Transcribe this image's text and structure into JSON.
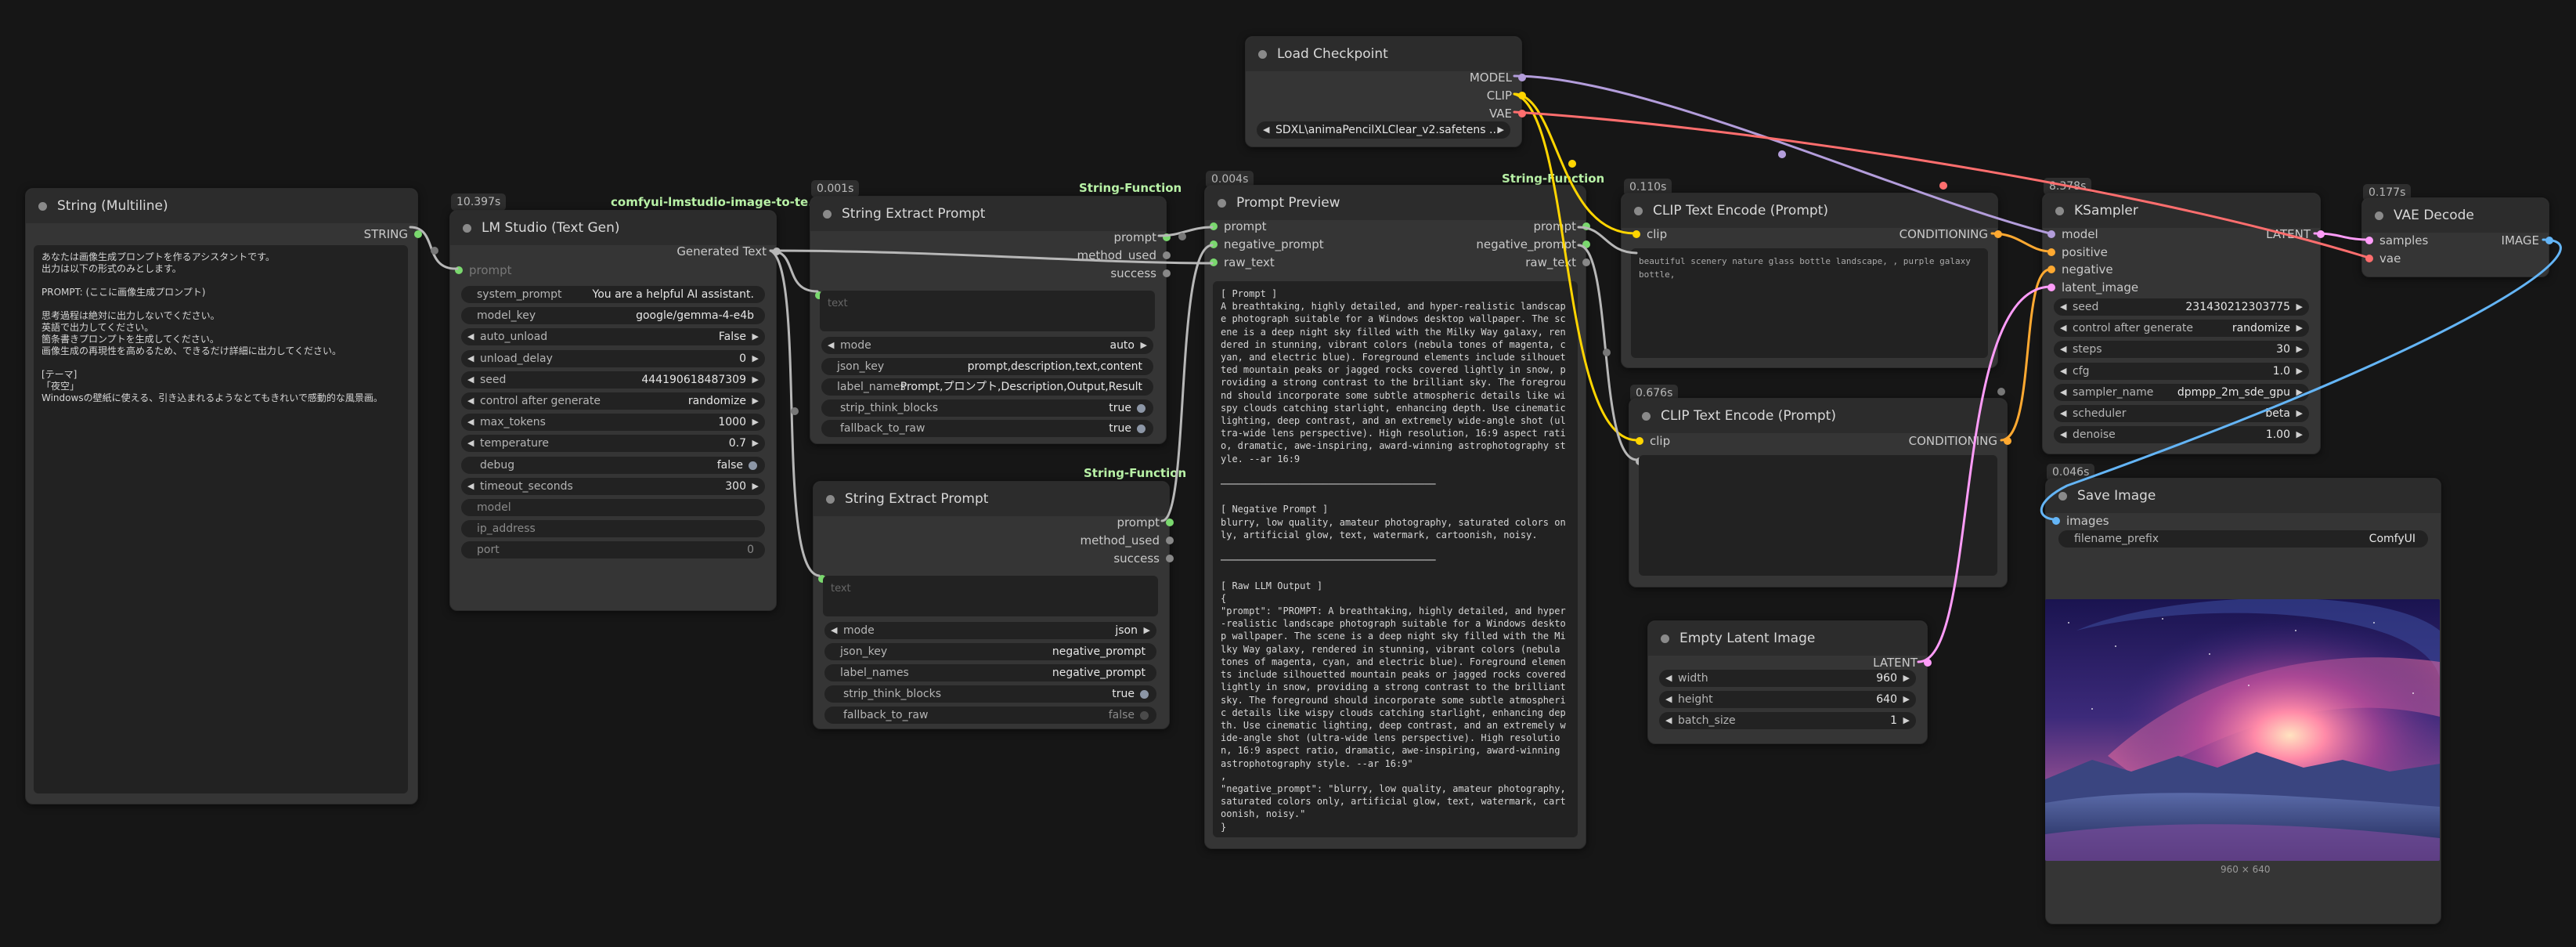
{
  "colors": {
    "model": "#b39ddb",
    "clip": "#ffd500",
    "vae": "#ff6e6e",
    "conditioning": "#ffa931",
    "latent": "#ff9cf9",
    "image": "#64b5f6",
    "string": "#7ad86e",
    "wire": "#b7b7b7"
  },
  "nodes": {
    "string_multiline": {
      "title": "String (Multiline)",
      "out_string": "STRING",
      "text": "あなたは画像生成プロンプトを作るアシスタントです。\n出力は以下の形式のみとします。\n\nPROMPT: (ここに画像生成プロンプト)\n\n思考過程は絶対に出力しないでください。\n英語で出力してください。\n箇条書きプロンプトを生成してください。\n画像生成の再現性を高めるため、できるだけ詳細に出力してください。\n\n[テーマ]\n「夜空」\nWindowsの壁紙に使える、引き込まれるようなとてもきれいで感動的な風景画。"
    },
    "lm_studio": {
      "badge": "10.397s",
      "tag": "comfyui-lmstudio-image-to-te...",
      "title": "LM Studio (Text Gen)",
      "out_generated": "Generated Text",
      "in_prompt": "prompt",
      "widgets": [
        {
          "label": "system_prompt",
          "value": "You are a helpful AI assistant.",
          "kind": "plain"
        },
        {
          "label": "model_key",
          "value": "google/gemma-4-e4b",
          "kind": "plain"
        },
        {
          "label": "auto_unload",
          "value": "False",
          "kind": "combo"
        },
        {
          "label": "unload_delay",
          "value": "0",
          "kind": "number"
        },
        {
          "label": "seed",
          "value": "444190618487309",
          "kind": "number"
        },
        {
          "label": "control after generate",
          "value": "randomize",
          "kind": "combo"
        },
        {
          "label": "max_tokens",
          "value": "1000",
          "kind": "number"
        },
        {
          "label": "temperature",
          "value": "0.7",
          "kind": "number"
        },
        {
          "label": "debug",
          "value": "false",
          "kind": "toggle"
        },
        {
          "label": "timeout_seconds",
          "value": "300",
          "kind": "number"
        },
        {
          "label": "model",
          "value": "",
          "kind": "plain"
        },
        {
          "label": "ip_address",
          "value": "",
          "kind": "plain"
        },
        {
          "label": "port",
          "value": "0",
          "kind": "plain"
        }
      ]
    },
    "extract_1": {
      "badge": "0.001s",
      "tag": "String-Function",
      "title": "String Extract Prompt",
      "outputs": [
        "prompt",
        "method_used",
        "success"
      ],
      "input_placeholder": "text",
      "widgets": [
        {
          "label": "mode",
          "value": "auto",
          "kind": "combo"
        },
        {
          "label": "json_key",
          "value": "prompt,description,text,content",
          "kind": "plain"
        },
        {
          "label": "label_names",
          "value": "Prompt,プロンプト,Description,Output,Result",
          "kind": "plain"
        },
        {
          "label": "strip_think_blocks",
          "value": "true",
          "kind": "toggle"
        },
        {
          "label": "fallback_to_raw",
          "value": "true",
          "kind": "toggle"
        }
      ]
    },
    "extract_2": {
      "tag": "String-Function",
      "title": "String Extract Prompt",
      "outputs": [
        "prompt",
        "method_used",
        "success"
      ],
      "input_placeholder": "text",
      "widgets": [
        {
          "label": "mode",
          "value": "json",
          "kind": "combo"
        },
        {
          "label": "json_key",
          "value": "negative_prompt",
          "kind": "plain"
        },
        {
          "label": "label_names",
          "value": "negative_prompt",
          "kind": "plain"
        },
        {
          "label": "strip_think_blocks",
          "value": "true",
          "kind": "toggle"
        },
        {
          "label": "fallback_to_raw",
          "value": "false",
          "kind": "toggle-off"
        }
      ]
    },
    "prompt_preview": {
      "badge": "0.004s",
      "tag": "String-Function",
      "title": "Prompt Preview",
      "inputs": [
        "prompt",
        "negative_prompt",
        "raw_text"
      ],
      "outputs": [
        "prompt",
        "negative_prompt",
        "raw_text"
      ],
      "text": "[ Prompt ]\nA breathtaking, highly detailed, and hyper-realistic landscape photograph suitable for a Windows desktop wallpaper. The scene is a deep night sky filled with the Milky Way galaxy, rendered in stunning, vibrant colors (nebula tones of magenta, cyan, and electric blue). Foreground elements include silhouetted mountain peaks or jagged rocks covered lightly in snow, providing a strong contrast to the brilliant sky. The foreground should incorporate some subtle atmospheric details like wispy clouds catching starlight, enhancing depth. Use cinematic lighting, deep contrast, and an extremely wide-angle shot (ultra-wide lens perspective). High resolution, 16:9 aspect ratio, dramatic, awe-inspiring, award-winning astrophotography style. --ar 16:9\n\n──────────────────────────────────────\n\n[ Negative Prompt ]\nblurry, low quality, amateur photography, saturated colors only, artificial glow, text, watermark, cartoonish, noisy.\n\n──────────────────────────────────────\n\n[ Raw LLM Output ]\n{\n\"prompt\": \"PROMPT: A breathtaking, highly detailed, and hyper-realistic landscape photograph suitable for a Windows desktop wallpaper. The scene is a deep night sky filled with the Milky Way galaxy, rendered in stunning, vibrant colors (nebula tones of magenta, cyan, and electric blue). Foreground elements include silhouetted mountain peaks or jagged rocks covered lightly in snow, providing a strong contrast to the brilliant sky. The foreground should incorporate some subtle atmospheric details like wispy clouds catching starlight, enhancing depth. Use cinematic lighting, deep contrast, and an extremely wide-angle shot (ultra-wide lens perspective). High resolution, 16:9 aspect ratio, dramatic, awe-inspiring, award-winning astrophotography style. --ar 16:9\"\n,\n\"negative_prompt\": \"blurry, low quality, amateur photography, saturated colors only, artificial glow, text, watermark, cartoonish, noisy.\"\n}"
    },
    "load_checkpoint": {
      "title": "Load Checkpoint",
      "outputs": [
        "MODEL",
        "CLIP",
        "VAE"
      ],
      "ckpt": "SDXL\\animaPencilXLClear_v2.safetens ..."
    },
    "clip_pos": {
      "badge": "0.110s",
      "title": "CLIP Text Encode (Prompt)",
      "in_clip": "clip",
      "out": "CONDITIONING",
      "text": "beautiful scenery nature glass bottle landscape, , purple galaxy bottle,"
    },
    "clip_neg": {
      "badge": "0.676s",
      "title": "CLIP Text Encode (Prompt)",
      "in_clip": "clip",
      "out": "CONDITIONING"
    },
    "ksampler": {
      "badge": "8.378s",
      "title": "KSampler",
      "inputs": [
        "model",
        "positive",
        "negative",
        "latent_image"
      ],
      "out": "LATENT",
      "widgets": [
        {
          "label": "seed",
          "value": "231430212303775",
          "kind": "number"
        },
        {
          "label": "control after generate",
          "value": "randomize",
          "kind": "combo"
        },
        {
          "label": "steps",
          "value": "30",
          "kind": "number"
        },
        {
          "label": "cfg",
          "value": "1.0",
          "kind": "number"
        },
        {
          "label": "sampler_name",
          "value": "dpmpp_2m_sde_gpu",
          "kind": "combo"
        },
        {
          "label": "scheduler",
          "value": "beta",
          "kind": "combo"
        },
        {
          "label": "denoise",
          "value": "1.00",
          "kind": "number"
        }
      ]
    },
    "vae_decode": {
      "badge": "0.177s",
      "title": "VAE Decode",
      "inputs": [
        "samples",
        "vae"
      ],
      "out": "IMAGE"
    },
    "empty_latent": {
      "title": "Empty Latent Image",
      "out": "LATENT",
      "widgets": [
        {
          "label": "width",
          "value": "960",
          "kind": "number"
        },
        {
          "label": "height",
          "value": "640",
          "kind": "number"
        },
        {
          "label": "batch_size",
          "value": "1",
          "kind": "number"
        }
      ]
    },
    "save_image": {
      "badge": "0.046s",
      "title": "Save Image",
      "in_images": "images",
      "prefix_label": "filename_prefix",
      "prefix_value": "ComfyUI",
      "caption": "960 × 640"
    }
  }
}
